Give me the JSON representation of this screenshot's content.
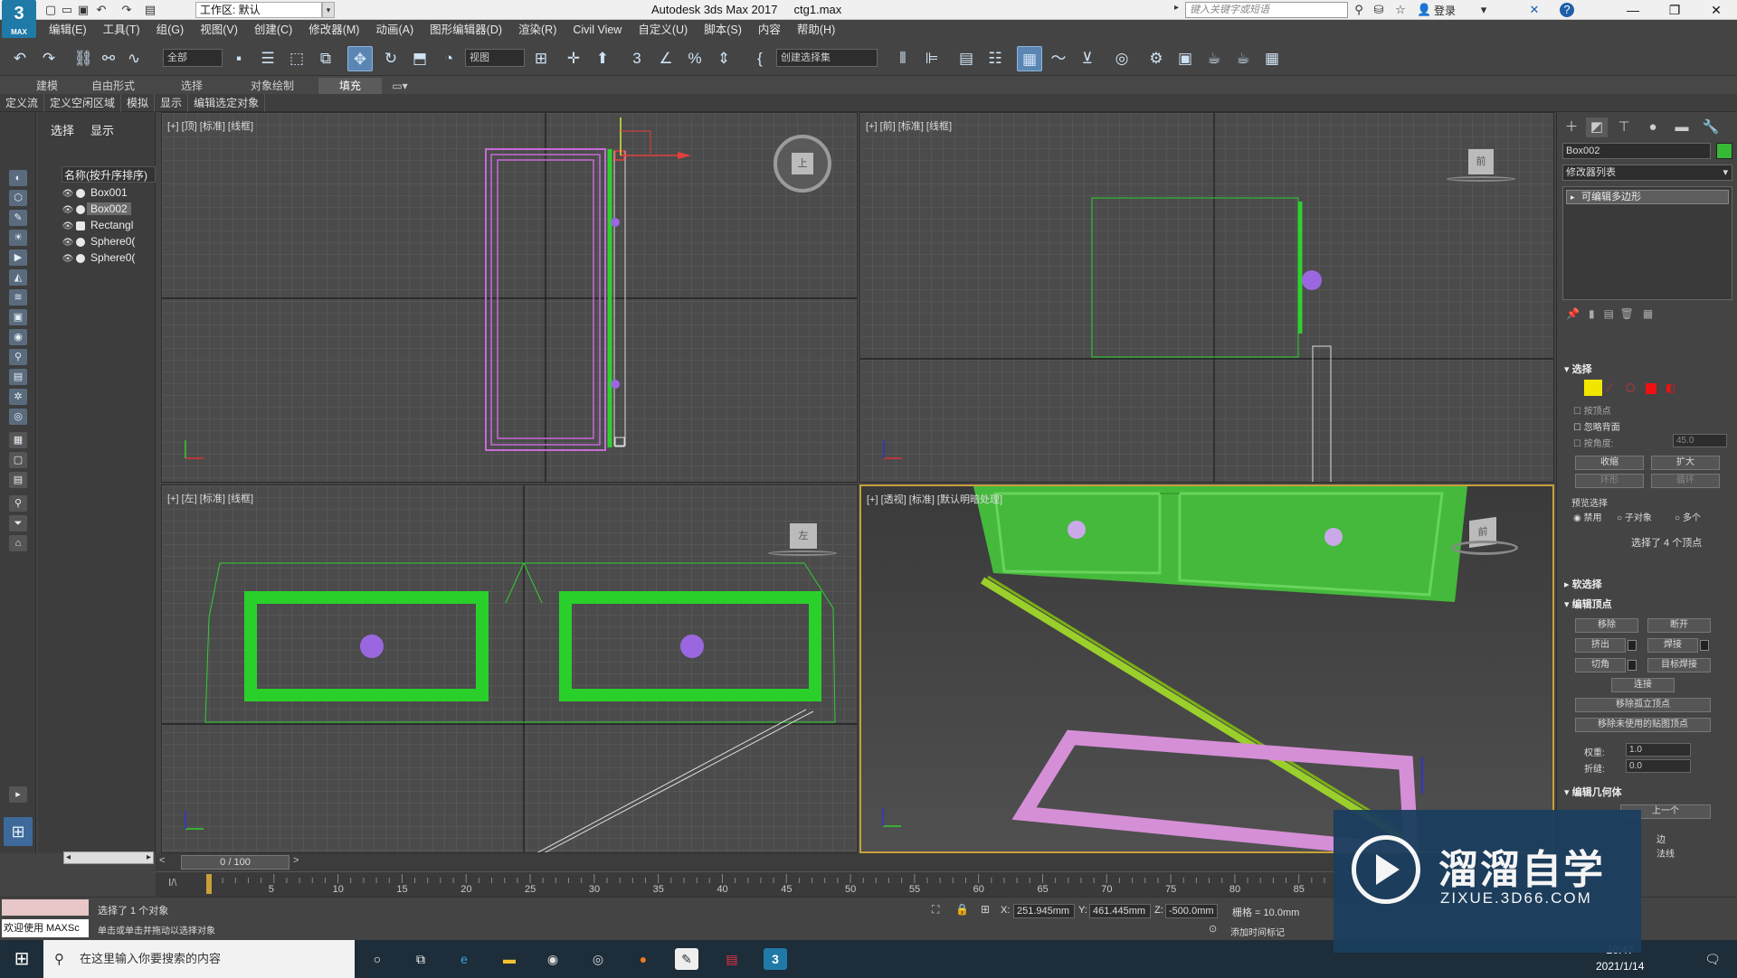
{
  "app": {
    "logo_text": "3",
    "logo_sub": "MAX",
    "title": "Autodesk 3ds Max 2017",
    "file": "ctg1.max",
    "workspace": "工作区: 默认",
    "search_placeholder": "键入关键字或短语",
    "login": "登录"
  },
  "menu": [
    "编辑(E)",
    "工具(T)",
    "组(G)",
    "视图(V)",
    "创建(C)",
    "修改器(M)",
    "动画(A)",
    "图形编辑器(D)",
    "渲染(R)",
    "Civil View",
    "自定义(U)",
    "脚本(S)",
    "内容",
    "帮助(H)"
  ],
  "toolbar": {
    "filter_value": "全部",
    "ref_coord_value": "视图",
    "named_selection_value": "创建选择集"
  },
  "ribbon": {
    "tabs": [
      "建模",
      "自由形式",
      "选择",
      "对象绘制",
      "填充"
    ],
    "active": "填充",
    "subtabs": [
      "定义流",
      "定义空闲区域",
      "模拟",
      "显示",
      "编辑选定对象"
    ]
  },
  "explorer": {
    "tabs": [
      "选择",
      "显示"
    ],
    "header": "名称(按升序排序)",
    "items": [
      {
        "name": "Box001",
        "selected": false
      },
      {
        "name": "Box002",
        "selected": true
      },
      {
        "name": "Rectangl",
        "selected": false
      },
      {
        "name": "Sphere0(",
        "selected": false
      },
      {
        "name": "Sphere0(",
        "selected": false
      }
    ]
  },
  "viewports": {
    "top": {
      "label": "[+] [顶] [标准] [线框]",
      "cube": "上"
    },
    "front": {
      "label": "[+] [前] [标准] [线框]",
      "cube": "前"
    },
    "left": {
      "label": "[+] [左] [标准] [线框]",
      "cube": "左"
    },
    "perspective": {
      "label": "[+] [透视] [标准] [默认明暗处理]"
    }
  },
  "command_panel": {
    "object_name": "Box002",
    "object_color": "#36b936",
    "modifier_list": "修改器列表",
    "stack_item": "可编辑多边形",
    "selection_rollout": "选择",
    "by_vertex": "按顶点",
    "ignore_backface": "忽略背面",
    "by_angle": "按角度:",
    "angle_value": "45.0",
    "shrink": "收缩",
    "grow": "扩大",
    "ring": "环形",
    "loop": "循环",
    "preview_selection": "预览选择",
    "preview_options": [
      "禁用",
      "子对象",
      "多个"
    ],
    "selected_info": "选择了 4 个顶点",
    "soft_selection": "软选择",
    "edit_vertices": "编辑顶点",
    "remove": "移除",
    "break": "断开",
    "extrude": "挤出",
    "weld": "焊接",
    "chamfer": "切角",
    "target_weld": "目标焊接",
    "connect": "连接",
    "remove_isolated": "移除孤立顶点",
    "remove_unused_map": "移除未使用的贴图顶点",
    "weight_label": "权重:",
    "weight_value": "1.0",
    "crease_label": "折缝:",
    "crease_value": "0.0",
    "edit_geometry": "编辑几何体",
    "prev": "上一个",
    "edge": "边",
    "face": "法线"
  },
  "timeline": {
    "frame": "0 / 100",
    "ticks": [
      "5",
      "10",
      "15",
      "20",
      "25",
      "30",
      "35",
      "40",
      "45",
      "50",
      "55",
      "60",
      "65",
      "70",
      "75",
      "80",
      "85"
    ]
  },
  "status": {
    "welcome": "欢迎使用 MAXSc",
    "selected": "选择了 1 个对象",
    "prompt": "单击或单击并拖动以选择对象",
    "x_label": "X:",
    "x_value": "251.945mm",
    "y_label": "Y:",
    "y_value": "461.445mm",
    "z_label": "Z:",
    "z_value": "-500.0mm",
    "grid": "栅格 = 10.0mm",
    "add_time_tag": "添加时间标记"
  },
  "taskbar": {
    "search_placeholder": "在这里输入你要搜索的内容",
    "time": "20:47",
    "date": "2021/1/14"
  },
  "watermark": {
    "title": "溜溜自学",
    "url": "ZIXUE.3D66.COM"
  }
}
